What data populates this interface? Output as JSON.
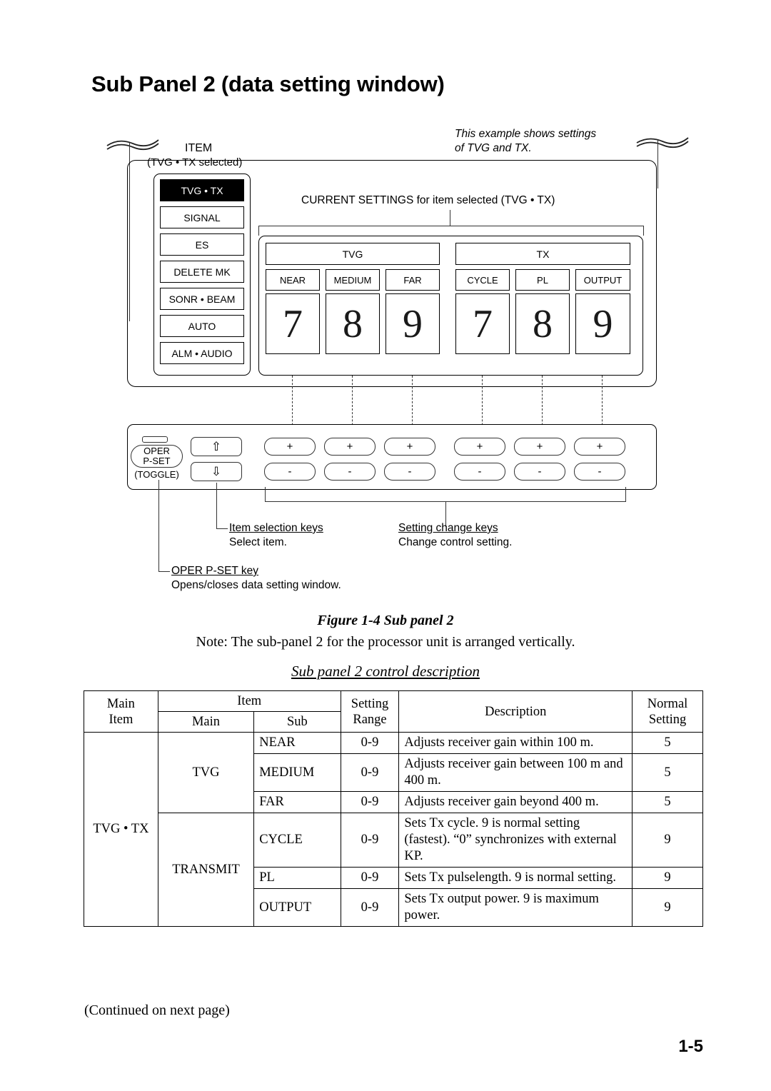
{
  "page": {
    "title": "Sub Panel 2 (data setting window)",
    "page_number": "1-5",
    "continued": "(Continued on next page)"
  },
  "figure": {
    "example_note_line1": "This example shows settings",
    "example_note_line2": "of TVG and TX.",
    "item_label": "ITEM",
    "item_sub_label": "(TVG • TX selected)",
    "current_settings_label": "CURRENT SETTINGS for item selected (TVG • TX)",
    "item_keys": [
      {
        "label": "TVG • TX",
        "selected": true
      },
      {
        "label": "SIGNAL",
        "selected": false
      },
      {
        "label": "ES",
        "selected": false
      },
      {
        "label": "DELETE MK",
        "selected": false
      },
      {
        "label": "SONR • BEAM",
        "selected": false
      },
      {
        "label": "AUTO",
        "selected": false
      },
      {
        "label": "ALM • AUDIO",
        "selected": false
      }
    ],
    "groups": [
      {
        "name": "TVG"
      },
      {
        "name": "TX"
      }
    ],
    "settings": [
      {
        "label": "NEAR",
        "value": "7"
      },
      {
        "label": "MEDIUM",
        "value": "8"
      },
      {
        "label": "FAR",
        "value": "9"
      },
      {
        "label": "CYCLE",
        "value": "7"
      },
      {
        "label": "PL",
        "value": "8"
      },
      {
        "label": "OUTPUT",
        "value": "9"
      }
    ],
    "oper_key": {
      "line1": "OPER",
      "line2": "P-SET",
      "toggle": "(TOGGLE)"
    },
    "arrow_keys": [
      {
        "glyph": "⇧"
      },
      {
        "glyph": "⇩"
      }
    ],
    "change_keys": [
      {
        "plus": "+",
        "minus": "-"
      },
      {
        "plus": "+",
        "minus": "-"
      },
      {
        "plus": "+",
        "minus": "-"
      },
      {
        "plus": "+",
        "minus": "-"
      },
      {
        "plus": "+",
        "minus": "-"
      },
      {
        "plus": "+",
        "minus": "-"
      }
    ],
    "callouts": {
      "item_selection_title": "Item selection keys",
      "item_selection_desc": "Select item.",
      "setting_change_title": "Setting change keys",
      "setting_change_desc": "Change control setting.",
      "oper_pset_title": "OPER P-SET key",
      "oper_pset_desc": "Opens/closes data setting window."
    },
    "caption": "Figure 1-4 Sub panel 2",
    "note": "Note: The sub-panel 2 for the processor unit is arranged vertically."
  },
  "table": {
    "caption": "Sub panel 2 control description",
    "headers": {
      "main_item_l1": "Main",
      "main_item_l2": "Item",
      "item": "Item",
      "item_main": "Main",
      "item_sub": "Sub",
      "setting_l1": "Setting",
      "setting_l2": "Range",
      "description": "Description",
      "normal_l1": "Normal",
      "normal_l2": "Setting"
    },
    "main_item": "TVG • TX",
    "groups": [
      {
        "name": "TVG",
        "rowspan": 3
      },
      {
        "name": "TRANSMIT",
        "rowspan": 3
      }
    ],
    "rows": [
      {
        "sub": "NEAR",
        "range": "0-9",
        "description": "Adjusts receiver gain within 100 m.",
        "normal": "5"
      },
      {
        "sub": "MEDIUM",
        "range": "0-9",
        "description": "Adjusts receiver gain between 100 m and 400 m.",
        "normal": "5"
      },
      {
        "sub": "FAR",
        "range": "0-9",
        "description": "Adjusts receiver gain beyond 400 m.",
        "normal": "5"
      },
      {
        "sub": "CYCLE",
        "range": "0-9",
        "description": "Sets Tx cycle. 9 is normal setting (fastest). “0” synchronizes with external KP.",
        "normal": "9"
      },
      {
        "sub": "PL",
        "range": "0-9",
        "description": "Sets Tx pulselength. 9 is normal setting.",
        "normal": "9"
      },
      {
        "sub": "OUTPUT",
        "range": "0-9",
        "description": "Sets Tx output power. 9 is maximum power.",
        "normal": "9"
      }
    ]
  }
}
